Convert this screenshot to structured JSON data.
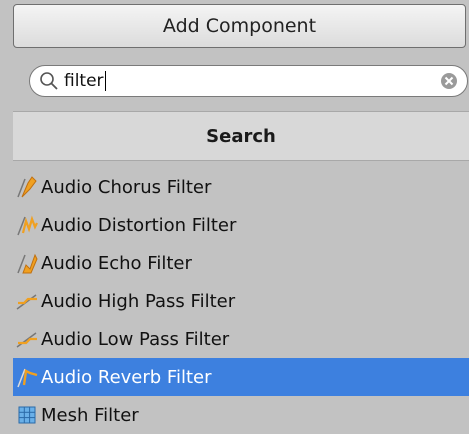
{
  "header": {
    "title": "Add Component"
  },
  "search": {
    "value": "filter"
  },
  "section": {
    "title": "Search"
  },
  "items": [
    {
      "label": "Audio Chorus Filter",
      "icon": "audio-chorus-filter-icon",
      "selected": false
    },
    {
      "label": "Audio Distortion Filter",
      "icon": "audio-distortion-filter-icon",
      "selected": false
    },
    {
      "label": "Audio Echo Filter",
      "icon": "audio-echo-filter-icon",
      "selected": false
    },
    {
      "label": "Audio High Pass Filter",
      "icon": "audio-high-pass-filter-icon",
      "selected": false
    },
    {
      "label": "Audio Low Pass Filter",
      "icon": "audio-low-pass-filter-icon",
      "selected": false
    },
    {
      "label": "Audio Reverb Filter",
      "icon": "audio-reverb-filter-icon",
      "selected": true
    },
    {
      "label": "Mesh Filter",
      "icon": "mesh-filter-icon",
      "selected": false
    }
  ],
  "colors": {
    "selection": "#3d80df",
    "panel": "#c2c2c2",
    "icon_accent": "#f0a020"
  }
}
